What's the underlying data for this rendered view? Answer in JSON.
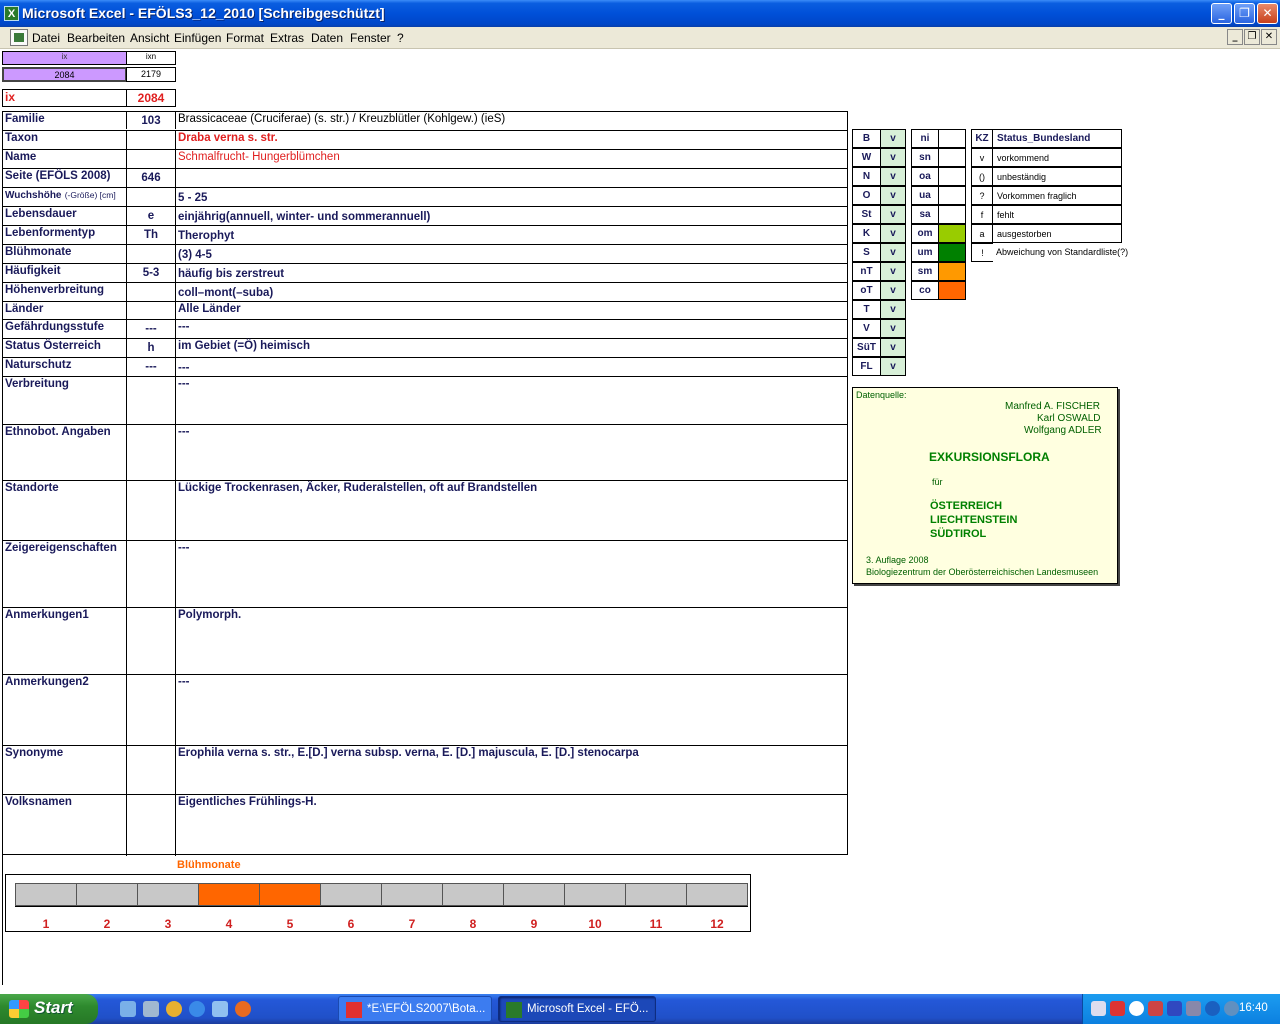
{
  "window": {
    "title": "Microsoft Excel - EFÖLS3_12_2010  [Schreibgeschützt]",
    "app_icon": "X",
    "min_icon": "minimize-icon",
    "max_icon": "restore-icon",
    "close_icon": "close-icon"
  },
  "menu": [
    "Datei",
    "Bearbeiten",
    "Ansicht",
    "Einfügen",
    "Format",
    "Extras",
    "Daten",
    "Fenster",
    "?"
  ],
  "topcells": {
    "ix_label": "ix",
    "ixn_label": "ixn",
    "ix_value": "2084",
    "ixn_value": "2179",
    "ix_big_label": "ix",
    "ix_big_value": "2084"
  },
  "rows": [
    {
      "label": "Familie",
      "code": "103",
      "value": "Brassicaceae (Cruciferae) (s. str.)  /  Kreuzblütler (Kohlgew.) (ieS)"
    },
    {
      "label": "Taxon",
      "code": "",
      "value": "Draba verna s. str."
    },
    {
      "label": "Name",
      "code": "",
      "value": "Schmalfrucht- Hungerblümchen"
    },
    {
      "label": "Seite (EFÖLS 2008)",
      "code": "646",
      "value": ""
    },
    {
      "label": "Wuchshöhe",
      "label_small": "(-Größe) [cm]",
      "code": "",
      "value": " 5 - 25"
    },
    {
      "label": "Lebensdauer",
      "code": "e",
      "value": "einjährig(annuell, winter- und sommerannuell)"
    },
    {
      "label": "Lebenformentyp",
      "code": "Th",
      "value": "Therophyt"
    },
    {
      "label": "Blühmonate",
      "code": "",
      "value": "(3) 4-5"
    },
    {
      "label": "Häufigkeit",
      "code": "5-3",
      "value": "häufig bis zerstreut"
    },
    {
      "label": "Höhenverbreitung",
      "code": "",
      "value": "coll–mont(–suba)"
    },
    {
      "label": "Länder",
      "code": "",
      "value": "Alle Länder"
    },
    {
      "label": "Gefährdungsstufe",
      "code": "---",
      "value": "  ---"
    },
    {
      "label": "Status Österreich",
      "code": "h",
      "value": "im Gebiet (=Ö) heimisch"
    },
    {
      "label": "Naturschutz",
      "code": "---",
      "value": "---"
    },
    {
      "label": "Verbreitung",
      "code": "",
      "value": "---"
    },
    {
      "label": "Ethnobot. Angaben",
      "code": "",
      "value": "---"
    },
    {
      "label": "Standorte",
      "code": "",
      "value": "Lückige Trockenrasen, Äcker, Ruderalstellen, oft auf Brandstellen"
    },
    {
      "label": "Zeigereigenschaften",
      "code": "",
      "value": "---"
    },
    {
      "label": "Anmerkungen1",
      "code": "",
      "value": "Polymorph."
    },
    {
      "label": "Anmerkungen2",
      "code": "",
      "value": "---"
    },
    {
      "label": "Synonyme",
      "code": "",
      "value": "Erophila verna s. str., E.[D.] verna subsp. verna, E. [D.] majuscula, E. [D.] stenocarpa"
    },
    {
      "label": "Volksnamen",
      "code": "",
      "value": "Eigentliches Frühlings-H."
    }
  ],
  "bundesland": [
    {
      "k": "B",
      "v": "v"
    },
    {
      "k": "W",
      "v": "v"
    },
    {
      "k": "N",
      "v": "v"
    },
    {
      "k": "O",
      "v": "v"
    },
    {
      "k": "St",
      "v": "v"
    },
    {
      "k": "K",
      "v": "v"
    },
    {
      "k": "S",
      "v": "v"
    },
    {
      "k": "nT",
      "v": "v"
    },
    {
      "k": "oT",
      "v": "v"
    },
    {
      "k": "T",
      "v": "v"
    },
    {
      "k": "V",
      "v": "v"
    },
    {
      "k": "SüT",
      "v": "v"
    },
    {
      "k": "FL",
      "v": "v"
    }
  ],
  "hoehe": [
    {
      "k": "ni",
      "color": ""
    },
    {
      "k": "sn",
      "color": ""
    },
    {
      "k": "oa",
      "color": ""
    },
    {
      "k": "ua",
      "color": ""
    },
    {
      "k": "sa",
      "color": ""
    },
    {
      "k": "om",
      "color": "#99cc00"
    },
    {
      "k": "um",
      "color": "#008000"
    },
    {
      "k": "sm",
      "color": "#ff9900"
    },
    {
      "k": "co",
      "color": "#ff6600"
    }
  ],
  "status_legend": {
    "header_kz": "KZ",
    "header_title": "Status_Bundesland",
    "items": [
      {
        "k": "v",
        "t": "vorkommend"
      },
      {
        "k": "()",
        "t": "unbeständig"
      },
      {
        "k": "?",
        "t": "Vorkommen fraglich"
      },
      {
        "k": "f",
        "t": "fehlt"
      },
      {
        "k": "a",
        "t": "ausgestorben"
      },
      {
        "k": "!",
        "t": "Abweichung von Standardliste(?)"
      }
    ]
  },
  "source": {
    "label": "Datenquelle:",
    "authors": [
      "Manfred A. FISCHER",
      "Karl OSWALD",
      "Wolfgang ADLER"
    ],
    "title": "EXKURSIONSFLORA",
    "fuer": "für",
    "countries": [
      "ÖSTERREICH",
      "LIECHTENSTEIN",
      "SÜDTIROL"
    ],
    "edition": "3. Auflage 2008",
    "publisher": "Biologiezentrum der Oberösterreichischen Landesmuseen"
  },
  "bluehmonate": {
    "title": "Blühmonate",
    "months": [
      "1",
      "2",
      "3",
      "4",
      "5",
      "6",
      "7",
      "8",
      "9",
      "10",
      "11",
      "12"
    ],
    "active": [
      4,
      5
    ]
  },
  "taskbar": {
    "start": "Start",
    "tasks": [
      {
        "label": "*E:\\EFÖLS2007\\Bota..."
      },
      {
        "label": "Microsoft Excel - EFÖ..."
      }
    ],
    "clock": "16:40"
  }
}
